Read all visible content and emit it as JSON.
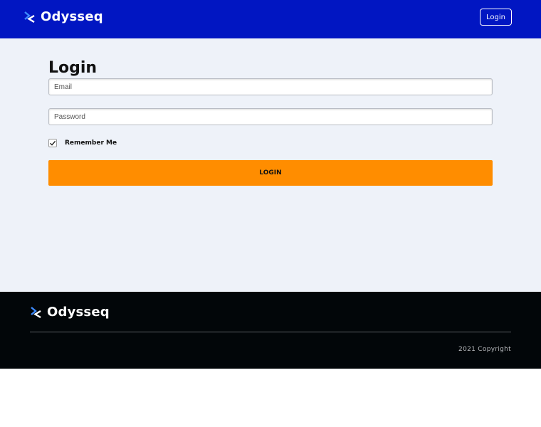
{
  "header": {
    "brand_name": "Odysseq",
    "logo_icon": "chevron-arrow-logo-icon",
    "login_link": "Login"
  },
  "login_form": {
    "title": "Login",
    "email_placeholder": "Email",
    "password_placeholder": "Password",
    "remember_me_label": "Remember Me",
    "remember_me_checked": true,
    "submit_label": "LOGIN"
  },
  "footer": {
    "brand_name": "Odysseq",
    "copyright": "2021 Copyright"
  },
  "colors": {
    "header_bg": "#0116c2",
    "main_bg": "#eef2f9",
    "accent_button": "#ff8d00",
    "footer_bg": "#020609",
    "logo_light": "#ffffff",
    "logo_blue": "#3d8bff"
  }
}
